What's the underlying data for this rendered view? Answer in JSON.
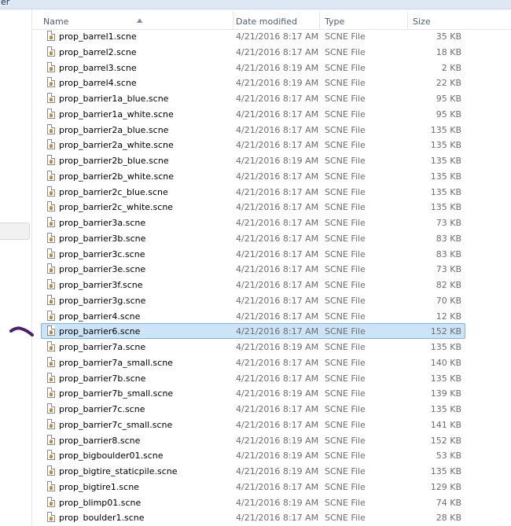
{
  "window": {
    "title_fragment": "er"
  },
  "columns": {
    "name": "Name",
    "date": "Date modified",
    "type": "Type",
    "size": "Size"
  },
  "files": [
    {
      "name": "prop_barrel1.scne",
      "date": "4/21/2016 8:17 AM",
      "type": "SCNE File",
      "size": "35 KB"
    },
    {
      "name": "prop_barrel2.scne",
      "date": "4/21/2016 8:17 AM",
      "type": "SCNE File",
      "size": "18 KB"
    },
    {
      "name": "prop_barrel3.scne",
      "date": "4/21/2016 8:19 AM",
      "type": "SCNE File",
      "size": "2 KB"
    },
    {
      "name": "prop_barrel4.scne",
      "date": "4/21/2016 8:19 AM",
      "type": "SCNE File",
      "size": "22 KB"
    },
    {
      "name": "prop_barrier1a_blue.scne",
      "date": "4/21/2016 8:17 AM",
      "type": "SCNE File",
      "size": "95 KB"
    },
    {
      "name": "prop_barrier1a_white.scne",
      "date": "4/21/2016 8:17 AM",
      "type": "SCNE File",
      "size": "95 KB"
    },
    {
      "name": "prop_barrier2a_blue.scne",
      "date": "4/21/2016 8:17 AM",
      "type": "SCNE File",
      "size": "135 KB"
    },
    {
      "name": "prop_barrier2a_white.scne",
      "date": "4/21/2016 8:17 AM",
      "type": "SCNE File",
      "size": "135 KB"
    },
    {
      "name": "prop_barrier2b_blue.scne",
      "date": "4/21/2016 8:19 AM",
      "type": "SCNE File",
      "size": "135 KB"
    },
    {
      "name": "prop_barrier2b_white.scne",
      "date": "4/21/2016 8:17 AM",
      "type": "SCNE File",
      "size": "135 KB"
    },
    {
      "name": "prop_barrier2c_blue.scne",
      "date": "4/21/2016 8:17 AM",
      "type": "SCNE File",
      "size": "135 KB"
    },
    {
      "name": "prop_barrier2c_white.scne",
      "date": "4/21/2016 8:17 AM",
      "type": "SCNE File",
      "size": "135 KB"
    },
    {
      "name": "prop_barrier3a.scne",
      "date": "4/21/2016 8:17 AM",
      "type": "SCNE File",
      "size": "73 KB"
    },
    {
      "name": "prop_barrier3b.scne",
      "date": "4/21/2016 8:17 AM",
      "type": "SCNE File",
      "size": "83 KB"
    },
    {
      "name": "prop_barrier3c.scne",
      "date": "4/21/2016 8:17 AM",
      "type": "SCNE File",
      "size": "83 KB"
    },
    {
      "name": "prop_barrier3e.scne",
      "date": "4/21/2016 8:17 AM",
      "type": "SCNE File",
      "size": "73 KB"
    },
    {
      "name": "prop_barrier3f.scne",
      "date": "4/21/2016 8:17 AM",
      "type": "SCNE File",
      "size": "82 KB"
    },
    {
      "name": "prop_barrier3g.scne",
      "date": "4/21/2016 8:17 AM",
      "type": "SCNE File",
      "size": "70 KB"
    },
    {
      "name": "prop_barrier4.scne",
      "date": "4/21/2016 8:17 AM",
      "type": "SCNE File",
      "size": "12 KB"
    },
    {
      "name": "prop_barrier6.scne",
      "date": "4/21/2016 8:17 AM",
      "type": "SCNE File",
      "size": "152 KB",
      "selected": true
    },
    {
      "name": "prop_barrier7a.scne",
      "date": "4/21/2016 8:19 AM",
      "type": "SCNE File",
      "size": "135 KB"
    },
    {
      "name": "prop_barrier7a_small.scne",
      "date": "4/21/2016 8:17 AM",
      "type": "SCNE File",
      "size": "140 KB"
    },
    {
      "name": "prop_barrier7b.scne",
      "date": "4/21/2016 8:17 AM",
      "type": "SCNE File",
      "size": "135 KB"
    },
    {
      "name": "prop_barrier7b_small.scne",
      "date": "4/21/2016 8:19 AM",
      "type": "SCNE File",
      "size": "139 KB"
    },
    {
      "name": "prop_barrier7c.scne",
      "date": "4/21/2016 8:17 AM",
      "type": "SCNE File",
      "size": "135 KB"
    },
    {
      "name": "prop_barrier7c_small.scne",
      "date": "4/21/2016 8:17 AM",
      "type": "SCNE File",
      "size": "141 KB"
    },
    {
      "name": "prop_barrier8.scne",
      "date": "4/21/2016 8:19 AM",
      "type": "SCNE File",
      "size": "152 KB"
    },
    {
      "name": "prop_bigboulder01.scne",
      "date": "4/21/2016 8:19 AM",
      "type": "SCNE File",
      "size": "53 KB"
    },
    {
      "name": "prop_bigtire_staticpile.scne",
      "date": "4/21/2016 8:19 AM",
      "type": "SCNE File",
      "size": "135 KB"
    },
    {
      "name": "prop_bigtire1.scne",
      "date": "4/21/2016 8:17 AM",
      "type": "SCNE File",
      "size": "129 KB"
    },
    {
      "name": "prop_blimp01.scne",
      "date": "4/21/2016 8:19 AM",
      "type": "SCNE File",
      "size": "74 KB"
    },
    {
      "name": "prop_boulder1.scne",
      "date": "4/21/2016 8:17 AM",
      "type": "SCNE File",
      "size": "28 KB"
    }
  ],
  "colors": {
    "selection_bg": "#cce4f7",
    "selection_border": "#7fb1e3",
    "pen_mark": "#4b1e6e"
  },
  "icons": {
    "file": "scne-file-icon",
    "sort": "sort-ascending-icon"
  }
}
